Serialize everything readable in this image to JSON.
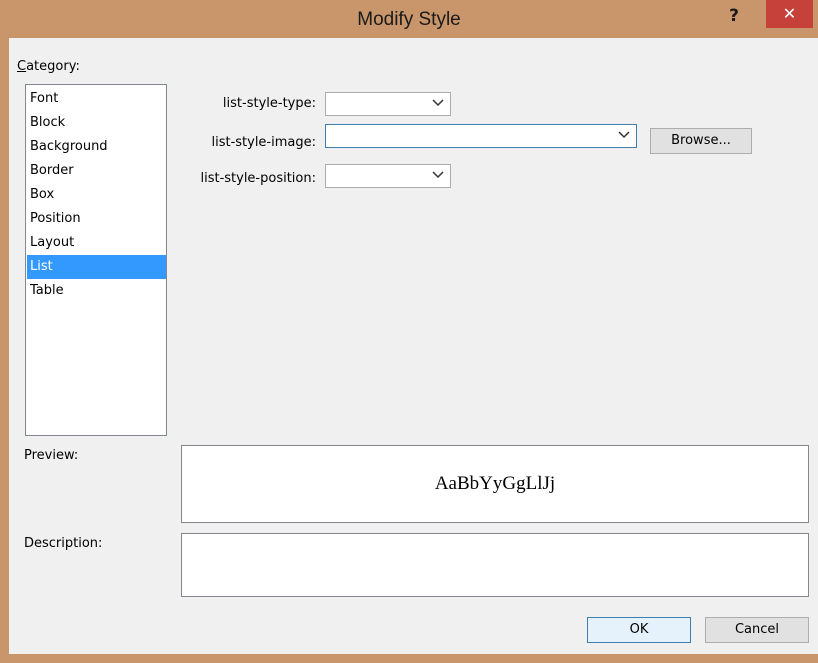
{
  "dialog": {
    "title": "Modify Style",
    "help_glyph": "?",
    "close_glyph": "✕"
  },
  "category": {
    "label": "Category:",
    "items": [
      "Font",
      "Block",
      "Background",
      "Border",
      "Box",
      "Position",
      "Layout",
      "List",
      "Table"
    ],
    "selected": "List"
  },
  "fields": {
    "list_style_type": {
      "label": "list-style-type:",
      "value": ""
    },
    "list_style_image": {
      "label": "list-style-image:",
      "value": ""
    },
    "list_style_position": {
      "label": "list-style-position:",
      "value": ""
    },
    "browse_label": "Browse..."
  },
  "preview": {
    "label": "Preview:",
    "sample_text": "AaBbYyGgLlJj"
  },
  "description": {
    "label": "Description:",
    "text": ""
  },
  "buttons": {
    "ok": "OK",
    "cancel": "Cancel"
  },
  "colors": {
    "titlebar": "#c9966b",
    "close": "#c7413b",
    "selection": "#3399ff",
    "client": "#f0f0f0"
  }
}
